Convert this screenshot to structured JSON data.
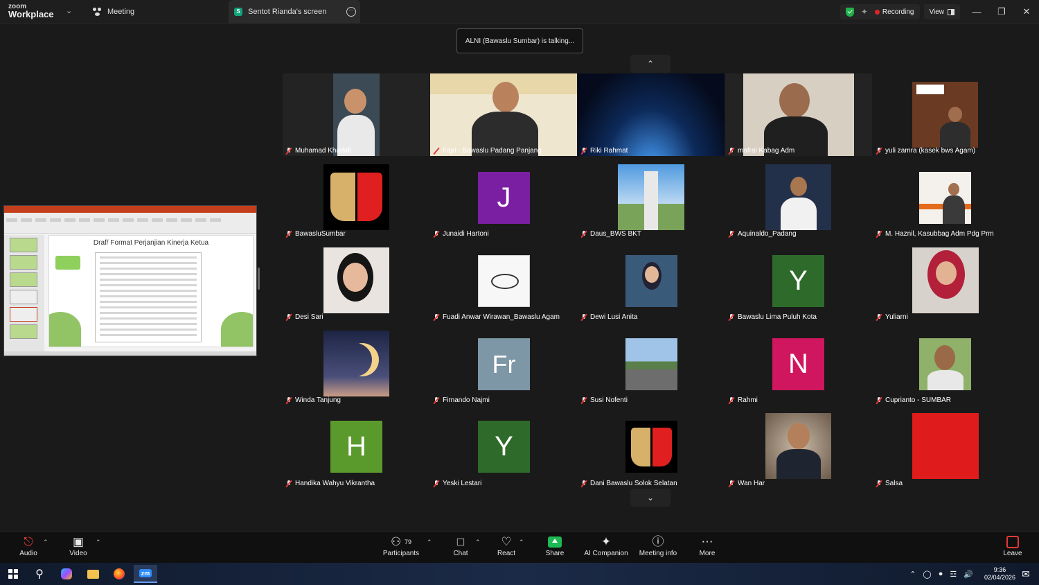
{
  "titlebar": {
    "logo_top": "zoom",
    "logo_bottom": "Workplace",
    "tab_meeting": "Meeting",
    "tab_screen_badge": "S",
    "tab_screen": "Sentot Rianda's screen",
    "recording_label": "Recording",
    "view_label": "View"
  },
  "banner": {
    "talking": "ALNI (Bawaslu Sumbar) is talking..."
  },
  "shared_slide": {
    "title": "Draf/ Format Perjanjian Kinerja Ketua"
  },
  "participants": [
    {
      "name": "Muhamad Khadafi"
    },
    {
      "name": "Fajri - Bawaslu Padang Panjang"
    },
    {
      "name": "Riki Rahmat"
    },
    {
      "name": "mafral Kabag Adm"
    },
    {
      "name": "yuli zamra (kasek bws Agam)"
    },
    {
      "name": "BawasluSumbar"
    },
    {
      "name": "Junaidi Hartoni",
      "letter": "J",
      "color": "#7b1fa2"
    },
    {
      "name": "Daus_BWS BKT"
    },
    {
      "name": "Aquinaldo_Padang"
    },
    {
      "name": "M. Haznil, Kasubbag Adm Pdg Prm"
    },
    {
      "name": "Desi Sari"
    },
    {
      "name": "Fuadi Anwar Wirawan_Bawaslu Agam"
    },
    {
      "name": "Dewi Lusi Anita"
    },
    {
      "name": "Bawaslu Lima Puluh Kota",
      "letter": "Y",
      "color": "#2e6b2a"
    },
    {
      "name": "Yuliarni"
    },
    {
      "name": "Winda Tanjung"
    },
    {
      "name": "Firnando Najmi",
      "letter": "Fr",
      "color": "#7e97a6"
    },
    {
      "name": "Susi Nofenti"
    },
    {
      "name": "Rahmi",
      "letter": "N",
      "color": "#d0165f"
    },
    {
      "name": "Cuprianto - SUMBAR"
    },
    {
      "name": "Handika Wahyu Vikrantha",
      "letter": "H",
      "color": "#5a9a2c"
    },
    {
      "name": "Yeski Lestari",
      "letter": "Y",
      "color": "#2e6b2a"
    },
    {
      "name": "Dani Bawaslu Solok Selatan"
    },
    {
      "name": "Wan Har"
    },
    {
      "name": "Salsa",
      "color": "#e01b1b"
    }
  ],
  "toolbar": {
    "audio": "Audio",
    "video": "Video",
    "participants": "Participants",
    "participants_count": "79",
    "chat": "Chat",
    "react": "React",
    "share": "Share",
    "ai_companion": "AI Companion",
    "meeting_info": "Meeting info",
    "more": "More",
    "leave": "Leave"
  },
  "taskbar": {
    "zoom_app": "zm",
    "time": "9:36",
    "date": "02/04/2026"
  },
  "colors": {
    "accent_green": "#1db954",
    "record_red": "#e02424",
    "mic_off_red": "#e53935"
  }
}
